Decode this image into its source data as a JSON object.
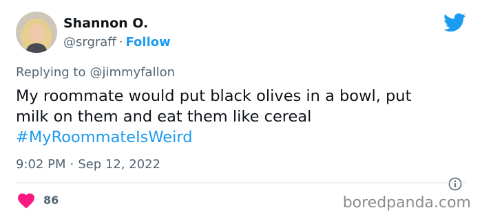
{
  "author": {
    "name": "Shannon O.",
    "handle": "@srgraff",
    "separator": "·",
    "follow_label": "Follow"
  },
  "reply": {
    "prefix": "Replying to",
    "mention": "@jimmyfallon"
  },
  "tweet": {
    "line1": "My roommate would put black olives in a bowl, put",
    "line2": "milk on them and eat them like cereal",
    "hashtag": "#MyRoommateIsWeird"
  },
  "meta": {
    "time": "9:02 PM",
    "separator": "·",
    "date": "Sep 12, 2022"
  },
  "engagement": {
    "likes": "86"
  },
  "watermark": "boredpanda.com",
  "icons": {
    "brand": "twitter-bird-icon",
    "info": "info-icon",
    "like": "heart-icon"
  },
  "colors": {
    "link": "#1d9bf0",
    "muted": "#536471",
    "heart": "#f91880"
  }
}
